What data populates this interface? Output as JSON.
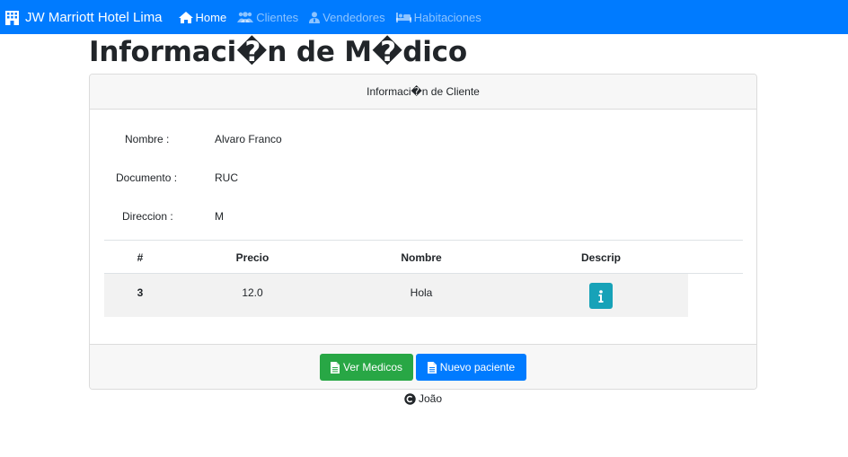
{
  "navbar": {
    "brand": "JW Marriott Hotel Lima",
    "brand_icon": "building-icon",
    "items": [
      {
        "label": "Home",
        "icon": "home-icon",
        "active": true
      },
      {
        "label": "Clientes",
        "icon": "users-icon",
        "active": false
      },
      {
        "label": "Vendedores",
        "icon": "user-tie-icon",
        "active": false
      },
      {
        "label": "Habitaciones",
        "icon": "bed-icon",
        "active": false
      }
    ],
    "color": "#007bff"
  },
  "page": {
    "title": "Informaci�n de M�dico"
  },
  "card": {
    "header": "Informaci�n de Cliente",
    "fields": [
      {
        "label": "Nombre :",
        "value": "Alvaro Franco"
      },
      {
        "label": "Documento :",
        "value": "RUC"
      },
      {
        "label": "Direccion :",
        "value": "M"
      }
    ],
    "table": {
      "columns": [
        "#",
        "Precio",
        "Nombre",
        "Descrip"
      ],
      "rows": [
        {
          "id": "3",
          "precio": "12.0",
          "nombre": "Hola",
          "descrip_icon": "info-icon"
        }
      ]
    },
    "buttons": {
      "ver_medicos": "Ver Medicos",
      "nuevo_paciente": "Nuevo paciente"
    }
  },
  "footer": {
    "link": "João",
    "icon": "copyright-icon"
  },
  "colors": {
    "primary": "#007bff",
    "success": "#28a745",
    "info": "#17a2b8"
  }
}
